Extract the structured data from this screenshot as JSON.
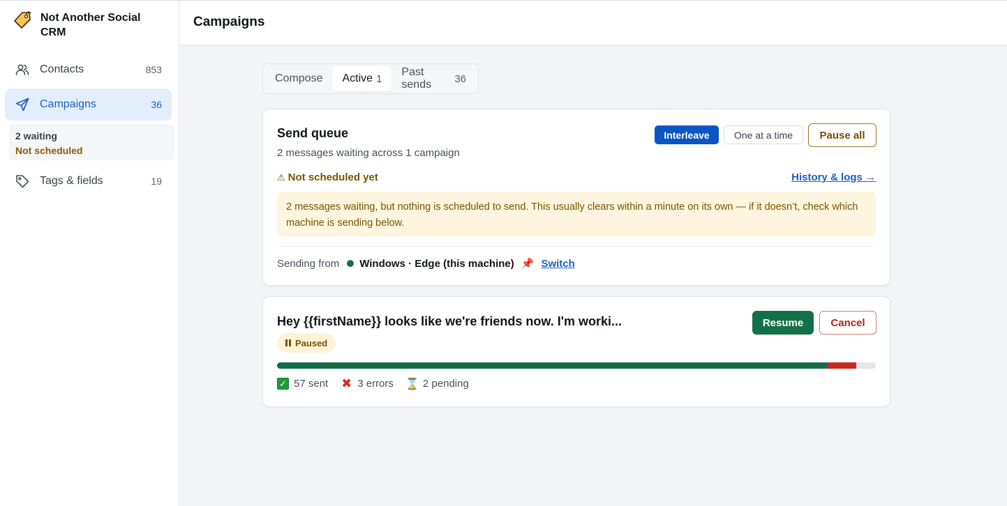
{
  "app": {
    "name": "Not Another Social CRM"
  },
  "sidebar": {
    "items": [
      {
        "label": "Contacts",
        "count": "853",
        "icon": "users-icon"
      },
      {
        "label": "Campaigns",
        "count": "36",
        "icon": "send-icon",
        "active": true
      },
      {
        "label": "Tags & fields",
        "count": "19",
        "icon": "tag-icon"
      }
    ],
    "status": {
      "waiting": "2 waiting",
      "schedule": "Not scheduled"
    }
  },
  "header": {
    "title": "Campaigns"
  },
  "tabs": [
    {
      "label": "Compose",
      "count": ""
    },
    {
      "label": "Active",
      "count": "1",
      "active": true
    },
    {
      "label": "Past sends",
      "count": "36"
    }
  ],
  "queue": {
    "title": "Send queue",
    "subtitle": "2 messages waiting across 1 campaign",
    "mode_interleave": "Interleave",
    "mode_one": "One at a time",
    "pause_all": "Pause all",
    "warning": "Not scheduled yet",
    "history_link": "History & logs →",
    "alert": "2 messages waiting, but nothing is scheduled to send. This usually clears within a minute on its own — if it doesn’t, check which machine is sending below.",
    "sending_from_label": "Sending from",
    "machine": "Windows · Edge (this machine)",
    "switch_label": "Switch"
  },
  "campaign": {
    "title": "Hey {{firstName}} looks like we're friends now. I'm worki...",
    "status": "Paused",
    "resume_label": "Resume",
    "cancel_label": "Cancel",
    "sent": 57,
    "errors": 3,
    "pending": 2,
    "sent_text": "57 sent",
    "errors_text": "3 errors",
    "pending_text": "2 pending"
  },
  "colors": {
    "accent": "#0b55c4",
    "success": "#13704a",
    "error": "#c8281e",
    "warning": "#7a5300"
  }
}
